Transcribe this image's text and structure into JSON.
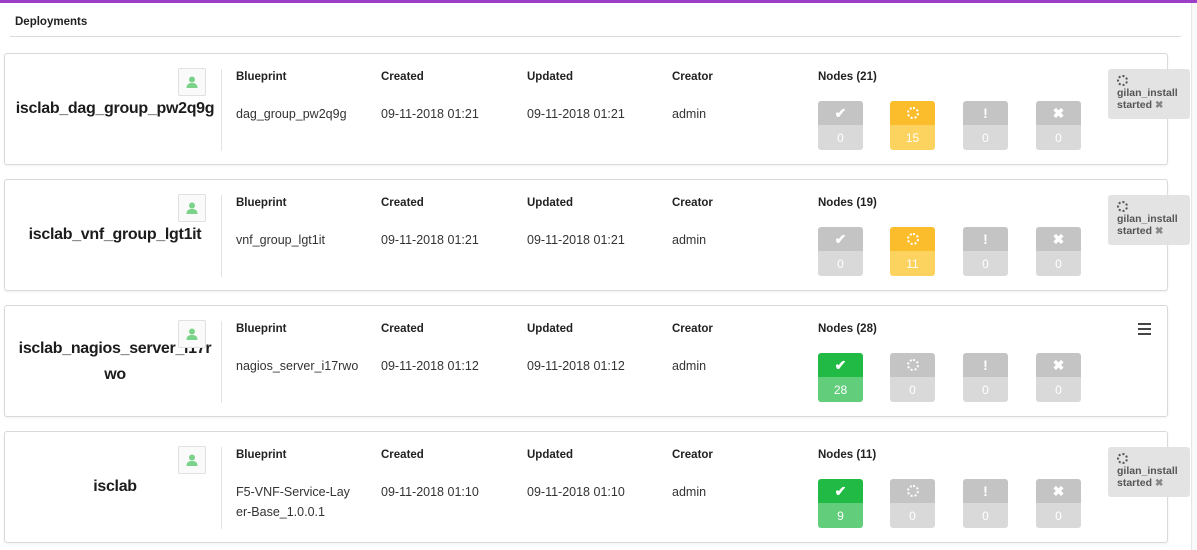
{
  "section": {
    "title": "Deployments"
  },
  "columns": {
    "blueprint": "Blueprint",
    "created": "Created",
    "updated": "Updated",
    "creator": "Creator"
  },
  "colors": {
    "accent": "#9b3fc8",
    "in_progress": "#fbbd2c",
    "success": "#21ba45",
    "neutral": "#c4c4c4"
  },
  "deployments": [
    {
      "name": "isclab_dag_group_pw2q9g",
      "blueprint": "dag_group_pw2q9g",
      "created": "09-11-2018 01:21",
      "updated": "09-11-2018 01:21",
      "creator": "admin",
      "nodes_label": "Nodes (21)",
      "nodes": {
        "started": "0",
        "in_progress": "15",
        "warning": "0",
        "failed": "0"
      },
      "execution": {
        "workflow": "gilan_install",
        "status": "started",
        "close": "✖"
      }
    },
    {
      "name": "isclab_vnf_group_lgt1it",
      "blueprint": "vnf_group_lgt1it",
      "created": "09-11-2018 01:21",
      "updated": "09-11-2018 01:21",
      "creator": "admin",
      "nodes_label": "Nodes (19)",
      "nodes": {
        "started": "0",
        "in_progress": "11",
        "warning": "0",
        "failed": "0"
      },
      "execution": {
        "workflow": "gilan_install",
        "status": "started",
        "close": "✖"
      }
    },
    {
      "name": "isclab_nagios_server_i17rwo",
      "blueprint": "nagios_server_i17rwo",
      "created": "09-11-2018 01:12",
      "updated": "09-11-2018 01:12",
      "creator": "admin",
      "nodes_label": "Nodes (28)",
      "nodes": {
        "started": "28",
        "in_progress": "0",
        "warning": "0",
        "failed": "0"
      },
      "execution": null
    },
    {
      "name": "isclab",
      "blueprint": "F5-VNF-Service-Layer-Base_1.0.0.1",
      "created": "09-11-2018 01:10",
      "updated": "09-11-2018 01:10",
      "creator": "admin",
      "nodes_label": "Nodes (11)",
      "nodes": {
        "started": "9",
        "in_progress": "0",
        "warning": "0",
        "failed": "0"
      },
      "execution": {
        "workflow": "gilan_install",
        "status": "started",
        "close": "✖"
      }
    }
  ]
}
